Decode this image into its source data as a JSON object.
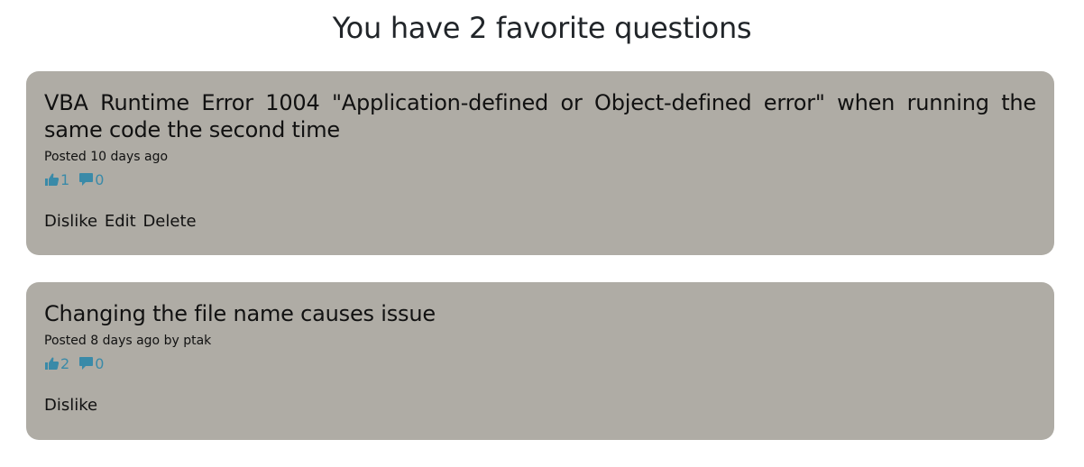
{
  "page": {
    "title": "You have 2 favorite questions"
  },
  "questions": [
    {
      "title": "VBA Runtime Error 1004 \"Application-defined or Object-defined error\" when running the same code the second time",
      "meta": "Posted 10 days ago",
      "likes": "1",
      "comments": "0",
      "actions": [
        "Dislike",
        "Edit",
        "Delete"
      ]
    },
    {
      "title": "Changing the file name causes issue",
      "meta": "Posted 8 days ago by ptak",
      "likes": "2",
      "comments": "0",
      "actions": [
        "Dislike"
      ]
    }
  ],
  "icons": {
    "like": "thumbs-up-icon",
    "comment": "comment-icon"
  },
  "colors": {
    "card_background": "#afaca5",
    "icon_accent": "#3a8aa8"
  }
}
